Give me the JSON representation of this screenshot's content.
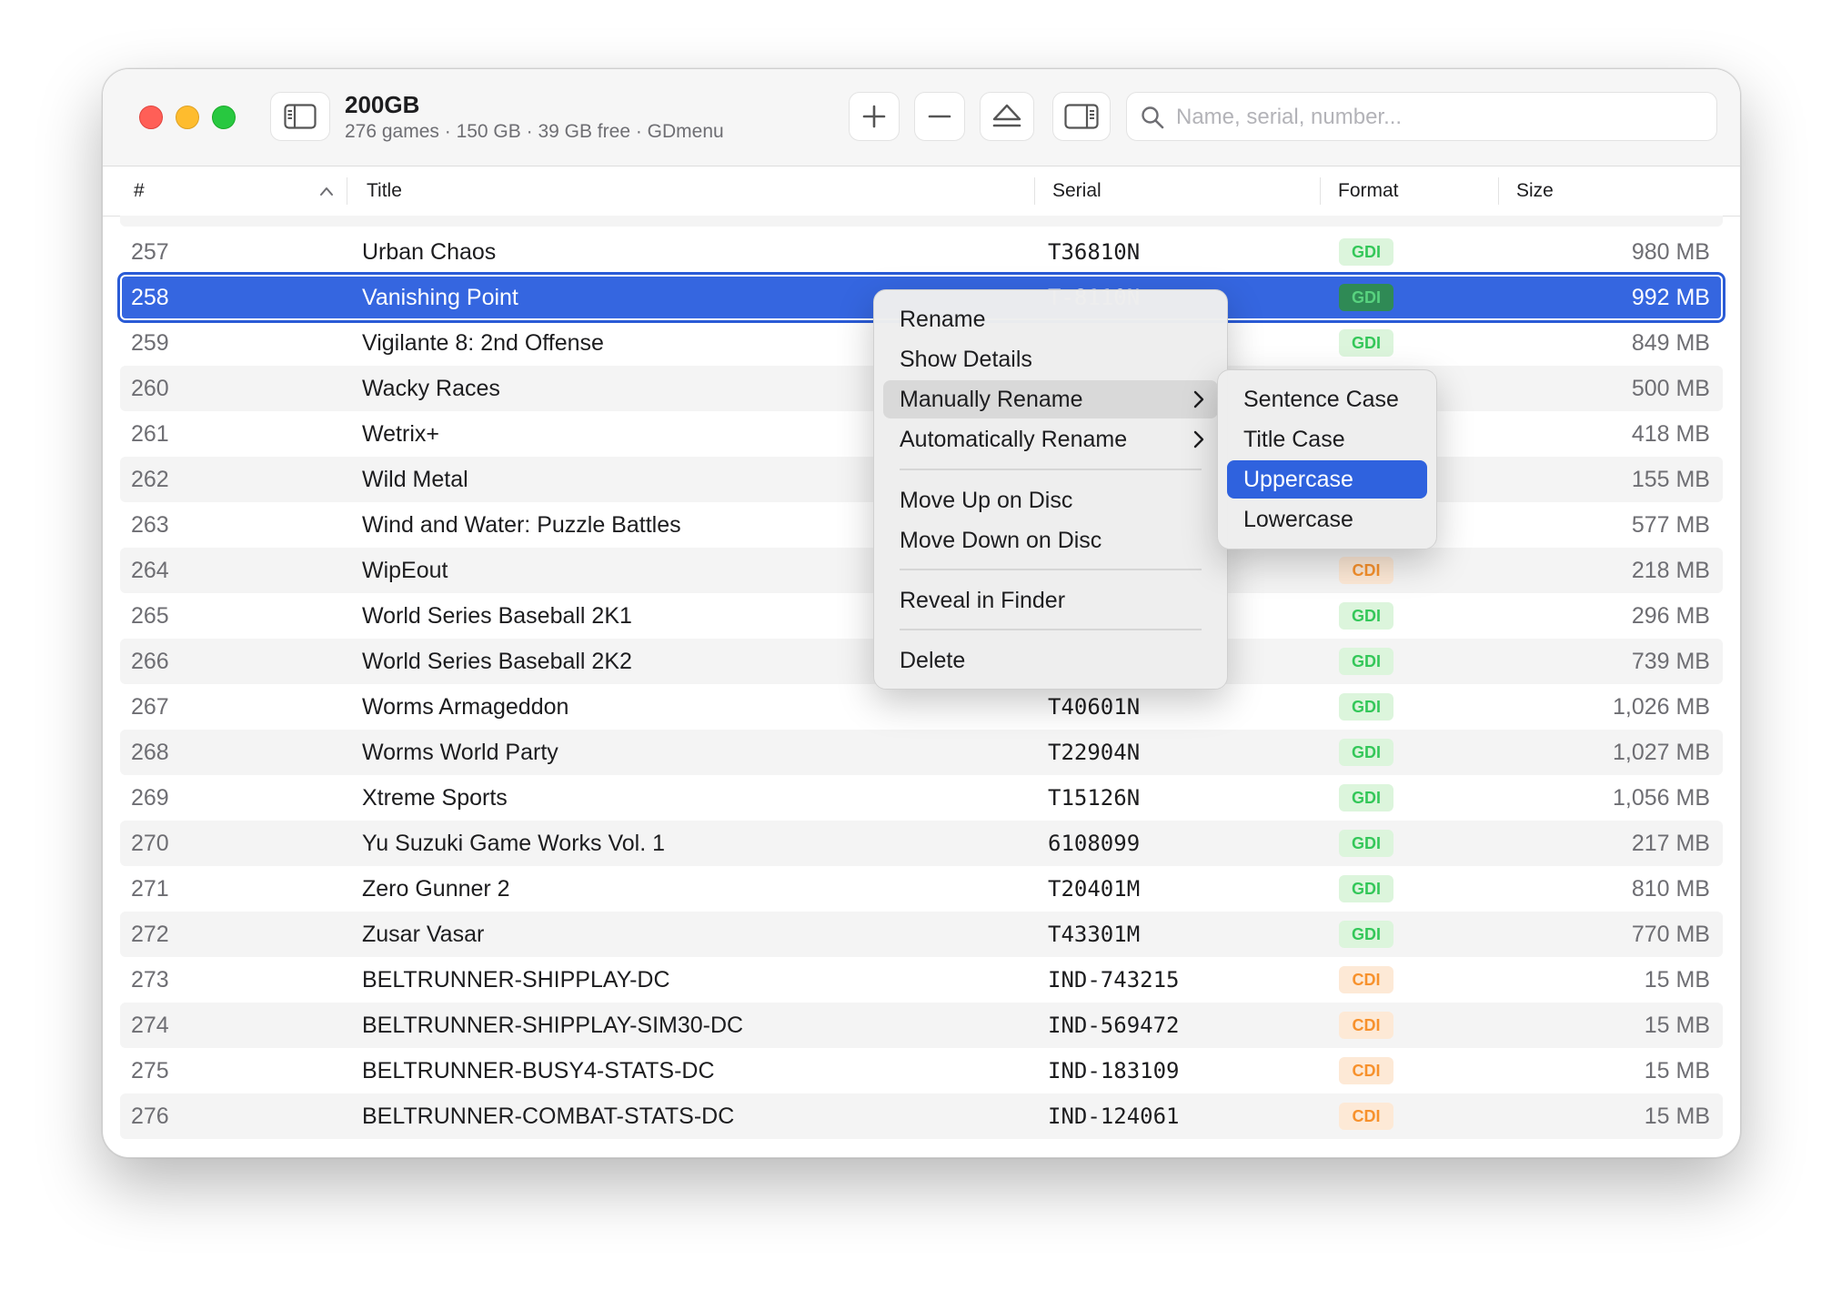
{
  "window": {
    "title": "200GB",
    "subtitle": "276 games · 150 GB · 39 GB free · GDmenu"
  },
  "search": {
    "placeholder": "Name, serial, number..."
  },
  "toolbar_icons": [
    "sidebar-icon",
    "plus-icon",
    "minus-icon",
    "eject-icon",
    "inspector-icon",
    "search-icon"
  ],
  "columns": {
    "num": "#",
    "title": "Title",
    "serial": "Serial",
    "format": "Format",
    "size": "Size"
  },
  "rows": [
    {
      "num": "257",
      "title": "Urban Chaos",
      "serial": "T36810N",
      "format": "GDI",
      "size": "980 MB"
    },
    {
      "num": "258",
      "title": "Vanishing Point",
      "serial": "T-8110N",
      "format": "GDI",
      "size": "992 MB",
      "selected": true
    },
    {
      "num": "259",
      "title": "Vigilante 8: 2nd Offense",
      "serial": "",
      "format": "GDI",
      "size": "849 MB"
    },
    {
      "num": "260",
      "title": "Wacky Races",
      "serial": "",
      "format": "",
      "size": "500 MB"
    },
    {
      "num": "261",
      "title": "Wetrix+",
      "serial": "",
      "format": "",
      "size": "418 MB"
    },
    {
      "num": "262",
      "title": "Wild Metal",
      "serial": "",
      "format": "",
      "size": "155 MB"
    },
    {
      "num": "263",
      "title": "Wind and Water: Puzzle Battles",
      "serial": "",
      "format": "",
      "size": "577 MB"
    },
    {
      "num": "264",
      "title": "WipEout",
      "serial": "",
      "format": "CDI",
      "size": "218 MB"
    },
    {
      "num": "265",
      "title": "World Series Baseball 2K1",
      "serial": "",
      "format": "GDI",
      "size": "296 MB"
    },
    {
      "num": "266",
      "title": "World Series Baseball 2K2",
      "serial": "",
      "format": "GDI",
      "size": "739 MB"
    },
    {
      "num": "267",
      "title": "Worms Armageddon",
      "serial": "T40601N",
      "format": "GDI",
      "size": "1,026 MB"
    },
    {
      "num": "268",
      "title": "Worms World Party",
      "serial": "T22904N",
      "format": "GDI",
      "size": "1,027 MB"
    },
    {
      "num": "269",
      "title": "Xtreme Sports",
      "serial": "T15126N",
      "format": "GDI",
      "size": "1,056 MB"
    },
    {
      "num": "270",
      "title": "Yu Suzuki Game Works Vol. 1",
      "serial": "6108099",
      "format": "GDI",
      "size": "217 MB"
    },
    {
      "num": "271",
      "title": "Zero Gunner 2",
      "serial": "T20401M",
      "format": "GDI",
      "size": "810 MB"
    },
    {
      "num": "272",
      "title": "Zusar Vasar",
      "serial": "T43301M",
      "format": "GDI",
      "size": "770 MB"
    },
    {
      "num": "273",
      "title": "BELTRUNNER-SHIPPLAY-DC",
      "serial": "IND-743215",
      "format": "CDI",
      "size": "15 MB"
    },
    {
      "num": "274",
      "title": "BELTRUNNER-SHIPPLAY-SIM30-DC",
      "serial": "IND-569472",
      "format": "CDI",
      "size": "15 MB"
    },
    {
      "num": "275",
      "title": "BELTRUNNER-BUSY4-STATS-DC",
      "serial": "IND-183109",
      "format": "CDI",
      "size": "15 MB"
    },
    {
      "num": "276",
      "title": "BELTRUNNER-COMBAT-STATS-DC",
      "serial": "IND-124061",
      "format": "CDI",
      "size": "15 MB"
    }
  ],
  "context_menu": {
    "rename": "Rename",
    "show_details": "Show Details",
    "manually_rename": "Manually Rename",
    "automatically_rename": "Automatically Rename",
    "move_up": "Move Up on Disc",
    "move_down": "Move Down on Disc",
    "reveal": "Reveal in Finder",
    "delete": "Delete"
  },
  "submenu": {
    "items": [
      "Sentence Case",
      "Title Case",
      "Uppercase",
      "Lowercase"
    ],
    "active": "Uppercase"
  },
  "colors": {
    "selection": "#3566e0",
    "gdi": "#34c759",
    "cdi": "#f7912c"
  }
}
